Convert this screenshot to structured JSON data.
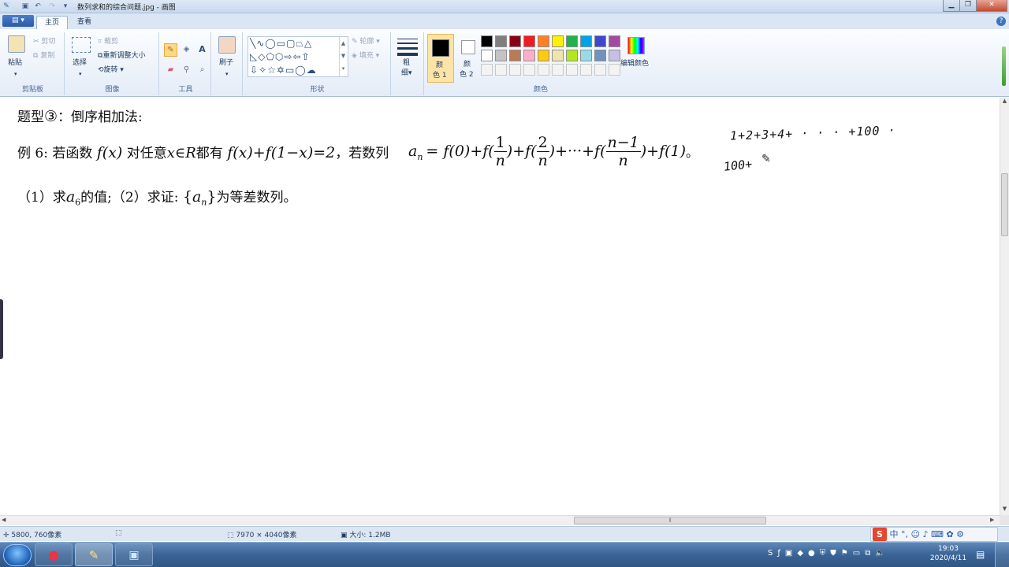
{
  "window": {
    "title": "数列求和的综合问题.jpg - 画图"
  },
  "tabs": [
    "主页",
    "查看"
  ],
  "ribbon": {
    "clipboard": {
      "paste": "粘贴",
      "cut": "剪切",
      "copy": "复制",
      "label": "剪贴板"
    },
    "image": {
      "select": "选择",
      "crop": "裁剪",
      "resize": "重新调整大小",
      "rotate": "旋转",
      "label": "图像"
    },
    "tools": {
      "label": "工具"
    },
    "brushes": {
      "label": "刷子"
    },
    "shapes": {
      "outline": "轮廓",
      "fill": "填充",
      "label": "形状"
    },
    "size": {
      "label1": "粗",
      "label2": "细"
    },
    "colors": {
      "color1_l1": "颜",
      "color1_l2": "色 1",
      "color2_l1": "颜",
      "color2_l2": "色 2",
      "edit": "编辑颜色",
      "label": "颜色",
      "color1": "#000000",
      "color2": "#ffffff",
      "palette_row1": [
        "#000000",
        "#7f7f7f",
        "#880015",
        "#ed1c24",
        "#ff7f27",
        "#fff200",
        "#22b14c",
        "#00a2e8",
        "#3f48cc",
        "#a349a4"
      ],
      "palette_row2": [
        "#ffffff",
        "#c3c3c3",
        "#b97a57",
        "#ffaec9",
        "#ffc90e",
        "#efe4b0",
        "#b5e61d",
        "#99d9ea",
        "#7092be",
        "#c8bfe7"
      ]
    }
  },
  "document": {
    "heading_prefix": "题型",
    "heading_num": "③",
    "heading_suffix": "：倒序相加法:",
    "ex_label": "例 6:",
    "ex_t1": "若函数",
    "ex_fx": "f(x)",
    "ex_t2": "对任意",
    "ex_xR": "x∈R",
    "ex_t3": "都有",
    "ex_eq": "f(x)+f(1−x)=2",
    "ex_t4": "，若数列",
    "an_a": "a",
    "an_n": "n",
    "eq_part1": "= f(0)+f(",
    "frac1_num": "1",
    "frac1_den": "n",
    "eq_part2": ")+f(",
    "frac2_num": "2",
    "frac2_den": "n",
    "eq_part3": ")+···+f(",
    "frac3_num": "n−1",
    "frac3_den": "n",
    "eq_part4": ")+f(1)",
    "eq_end": "。",
    "q_part1": "（1）求",
    "q_a6_a": "a",
    "q_a6_sub": "6",
    "q_part2": "的值;（2）求证:",
    "q_set_open": "{",
    "q_set_a": "a",
    "q_set_sub": "n",
    "q_set_close": "}",
    "q_part3": "为等差数列",
    "q_end": "。",
    "hand1": "1+2+3+4+ · · · +100 ·",
    "hand2": "100+"
  },
  "status": {
    "coords": "5800, 760像素",
    "dimensions": "7970 × 4040像素",
    "size": "大小: 1.2MB"
  },
  "taskbar": {
    "ime_items": [
      "中",
      "°,"
    ],
    "time": "19:03",
    "date": "2020/4/11"
  }
}
